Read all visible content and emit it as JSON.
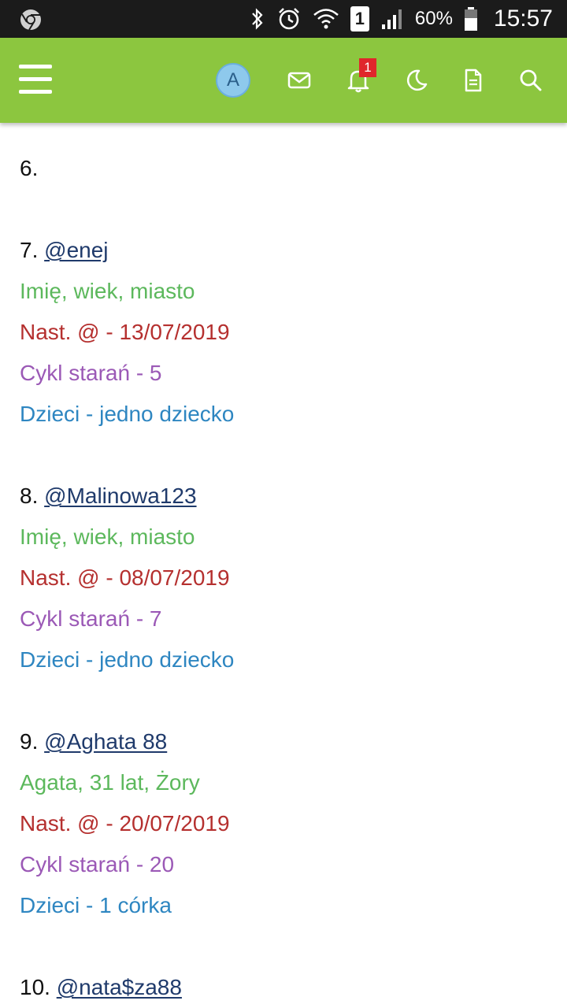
{
  "status_bar": {
    "battery": "60%",
    "time": "15:57",
    "sim": "1",
    "icons": [
      "chrome-icon",
      "bluetooth-icon",
      "alarm-icon",
      "wifi-icon",
      "signal-icon",
      "battery-icon"
    ]
  },
  "app_bar": {
    "avatar_letter": "A",
    "notification_count": "1",
    "background": "#8cc63f",
    "icons": [
      "menu-icon",
      "avatar",
      "mail-icon",
      "bell-icon",
      "moon-icon",
      "document-icon",
      "search-icon"
    ]
  },
  "list": {
    "entry6": {
      "number": "6."
    },
    "entry7": {
      "number": "7.",
      "username": "@enej",
      "info": "Imię, wiek, miasto",
      "next": "Nast. @ - 13/07/2019",
      "cycle": "Cykl starań - 5",
      "children": "Dzieci - jedno dziecko"
    },
    "entry8": {
      "number": "8.",
      "username": "@Malinowa123",
      "info": "Imię, wiek, miasto",
      "next": "Nast. @ - 08/07/2019",
      "cycle": "Cykl starań - 7",
      "children": "Dzieci - jedno dziecko"
    },
    "entry9": {
      "number": "9.",
      "username": "@Aghata 88",
      "info": "Agata, 31 lat, Żory",
      "next": "Nast. @ - 20/07/2019",
      "cycle": "Cykl starań - 20",
      "children": "Dzieci - 1 córka"
    },
    "entry10": {
      "number": "10.",
      "username": "@nata$za88"
    }
  },
  "colors": {
    "info": "#5cb85c",
    "next": "#b5302f",
    "cycle": "#9b59b6",
    "children": "#2e86c1",
    "username": "#1f3a6b"
  }
}
